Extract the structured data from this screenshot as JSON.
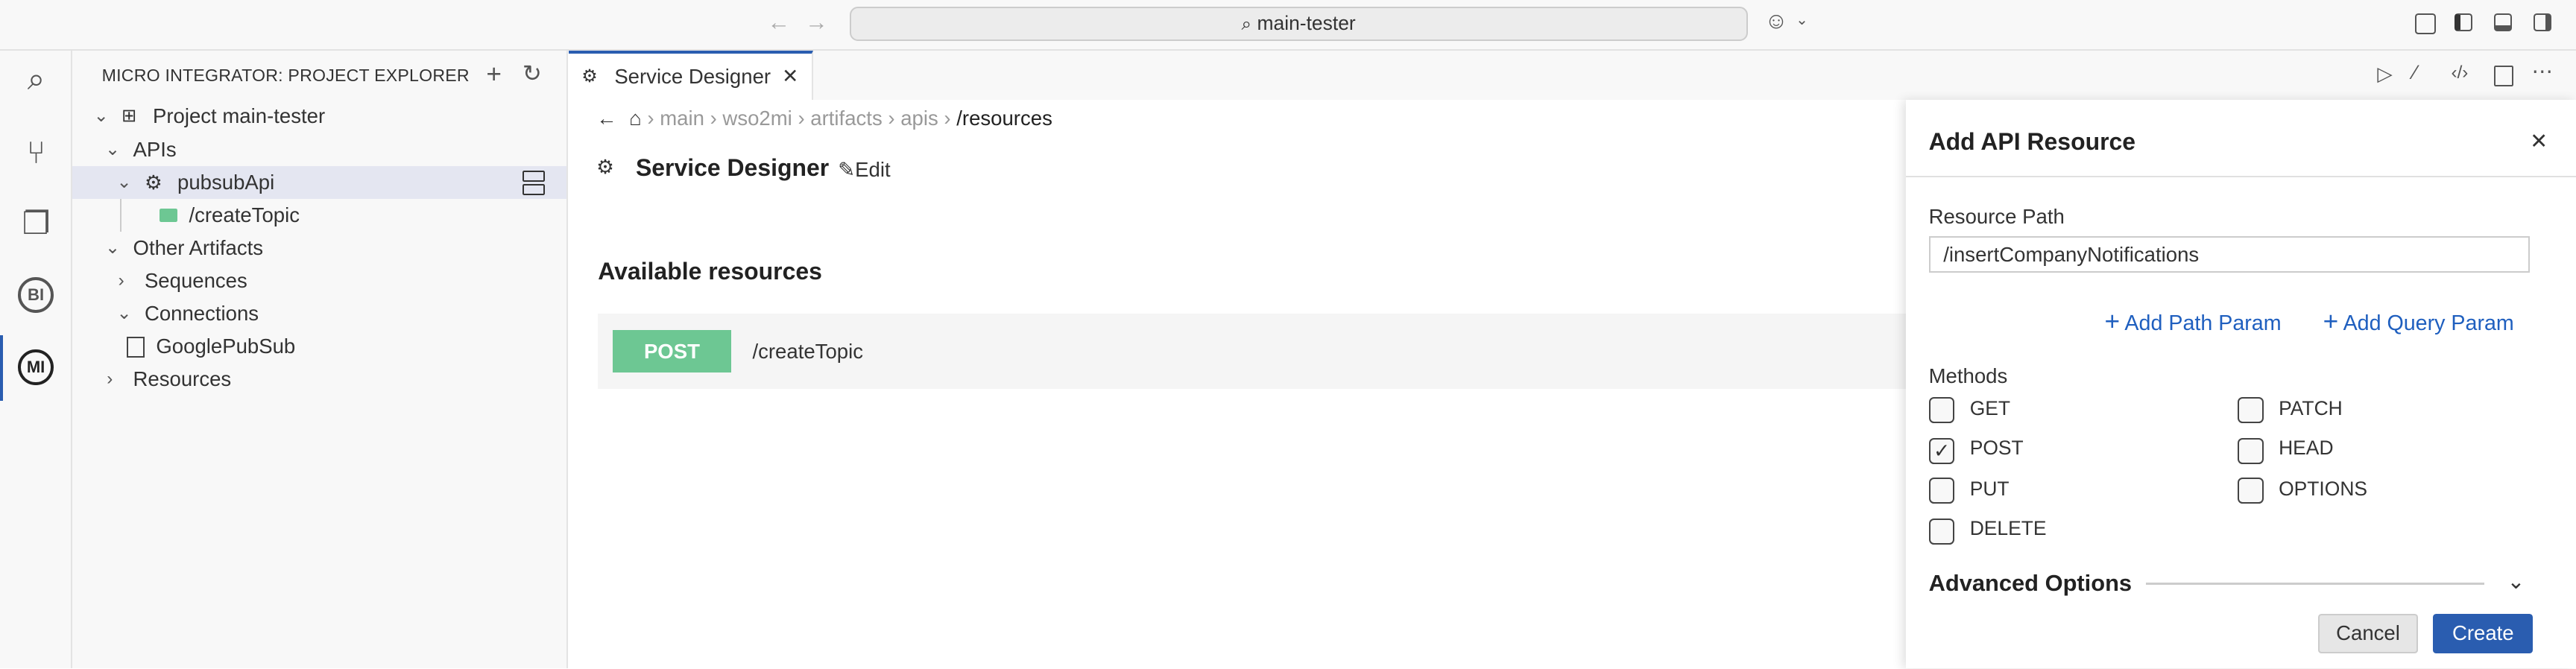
{
  "titlebar": {
    "search_text": "main-tester",
    "icons": [
      "arrow-left-icon",
      "arrow-right-icon",
      "search-icon",
      "copilot-icon",
      "layout-icons"
    ]
  },
  "activity_bar": {
    "items": [
      "search",
      "source-control",
      "explorer",
      "BI",
      "MI"
    ],
    "active": "MI"
  },
  "sidebar": {
    "title": "MICRO INTEGRATOR: PROJECT EXPLORER",
    "tree": [
      {
        "label": "Project main-tester",
        "state": "expanded"
      },
      {
        "label": "APIs",
        "state": "expanded"
      },
      {
        "label": "pubsubApi",
        "state": "expanded",
        "selected": true
      },
      {
        "label": "/createTopic",
        "badge": "POST"
      },
      {
        "label": "Other Artifacts",
        "state": "expanded"
      },
      {
        "label": "Sequences",
        "state": "collapsed"
      },
      {
        "label": "Connections",
        "state": "expanded"
      },
      {
        "label": "GooglePubSub"
      },
      {
        "label": "Resources",
        "state": "collapsed"
      }
    ]
  },
  "editor": {
    "tab_label": "Service Designer",
    "breadcrumb": [
      "main",
      "wso2mi",
      "artifacts",
      "apis",
      "/resources"
    ],
    "title": "Service Designer",
    "edit_label": "Edit",
    "section_title": "Available resources",
    "resources": [
      {
        "method": "POST",
        "path": "/createTopic"
      }
    ],
    "colors": {
      "post": "#6dc793",
      "accent": "#2a5db0"
    }
  },
  "panel": {
    "title": "Add API Resource",
    "resource_path_label": "Resource Path",
    "resource_path_value": "/insertCompanyNotifications",
    "add_path_param": "Add Path Param",
    "add_query_param": "Add Query Param",
    "methods_label": "Methods",
    "methods": [
      {
        "label": "GET",
        "checked": false
      },
      {
        "label": "POST",
        "checked": true
      },
      {
        "label": "PUT",
        "checked": false
      },
      {
        "label": "DELETE",
        "checked": false
      },
      {
        "label": "PATCH",
        "checked": false
      },
      {
        "label": "HEAD",
        "checked": false
      },
      {
        "label": "OPTIONS",
        "checked": false
      }
    ],
    "advanced_options": "Advanced Options",
    "cancel": "Cancel",
    "create": "Create"
  }
}
